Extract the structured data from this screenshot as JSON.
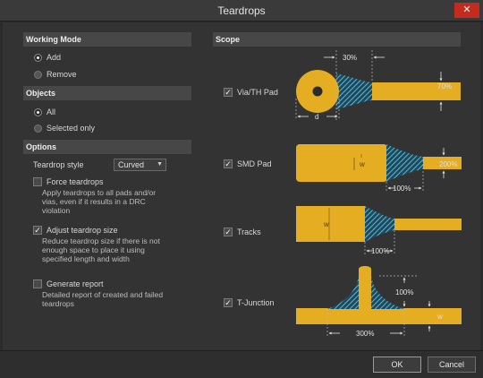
{
  "window": {
    "title": "Teardrops",
    "close_glyph": "✕"
  },
  "working_mode": {
    "header": "Working Mode",
    "options": [
      {
        "label": "Add",
        "selected": true
      },
      {
        "label": "Remove",
        "selected": false
      }
    ]
  },
  "objects": {
    "header": "Objects",
    "options": [
      {
        "label": "All",
        "selected": true
      },
      {
        "label": "Selected only",
        "selected": false
      }
    ]
  },
  "options": {
    "header": "Options",
    "teardrop_style_label": "Teardrop style",
    "teardrop_style_value": "Curved",
    "force": {
      "label": "Force teardrops",
      "checked": false,
      "description": [
        "Apply teardrops to all pads and/or",
        "vias, even if it results in a DRC",
        "violation"
      ]
    },
    "adjust": {
      "label": "Adjust teardrop size",
      "checked": true,
      "description": [
        "Reduce teardrop size if there is not",
        "enough space to place it using",
        "specified length and width"
      ]
    },
    "report": {
      "label": "Generate report",
      "checked": false,
      "description": [
        "Detailed report of created and failed",
        "teardrops"
      ]
    }
  },
  "scope": {
    "header": "Scope",
    "items": [
      {
        "label": "Via/TH Pad",
        "checked": true
      },
      {
        "label": "SMD Pad",
        "checked": true
      },
      {
        "label": "Tracks",
        "checked": true
      },
      {
        "label": "T-Junction",
        "checked": true
      }
    ],
    "via_labels": {
      "length": "30%",
      "width": "70%",
      "diameter": "d"
    },
    "smd_labels": {
      "w": "w",
      "width": "200%",
      "length": "100%"
    },
    "tracks_labels": {
      "w": "w",
      "length": "100%"
    },
    "tjunction_labels": {
      "height": "100%",
      "w": "w",
      "length": "300%"
    }
  },
  "buttons": {
    "ok": "OK",
    "cancel": "Cancel"
  },
  "colors": {
    "copper": "#e5ad21",
    "hatch": "#4fc3f7"
  }
}
